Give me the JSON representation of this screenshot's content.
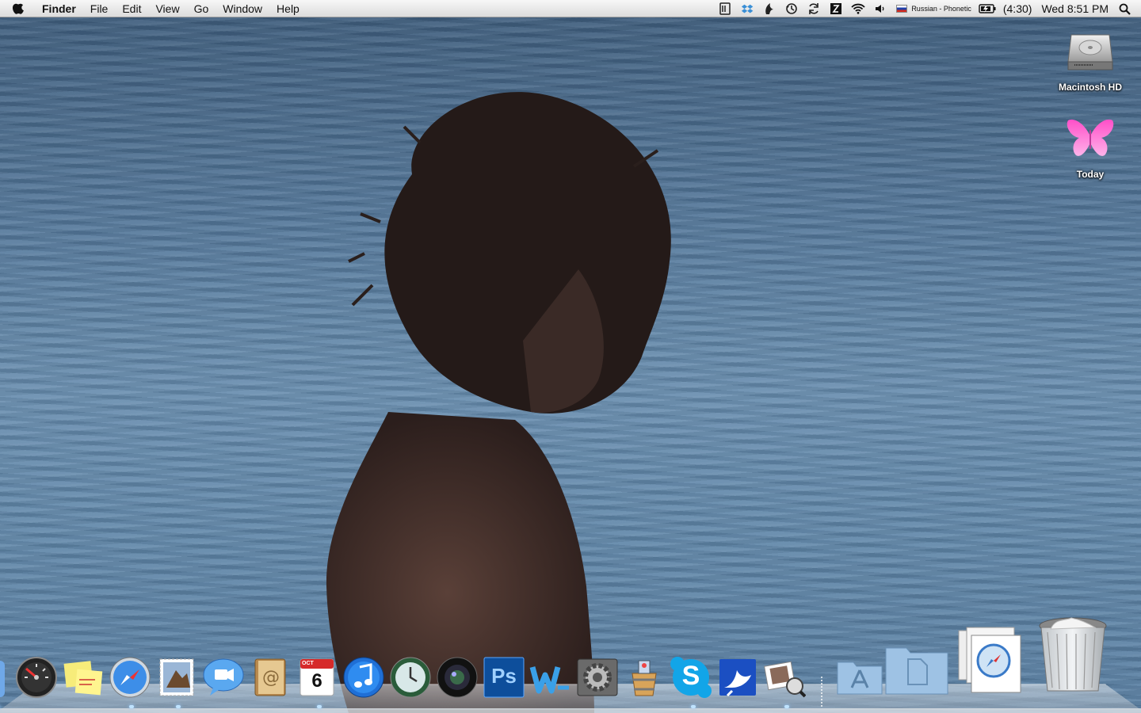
{
  "menubar": {
    "app_name": "Finder",
    "menus": [
      "File",
      "Edit",
      "View",
      "Go",
      "Window",
      "Help"
    ],
    "status": {
      "input_source": "Russian - Phonetic",
      "battery_time": "(4:30)",
      "clock": "Wed 8:51 PM"
    }
  },
  "desktop": {
    "icons": [
      {
        "label": "Macintosh HD",
        "icon": "hard-drive-icon"
      },
      {
        "label": "Today",
        "icon": "butterfly-icon"
      }
    ]
  },
  "dock": {
    "apps": [
      "Dashboard",
      "Stickies",
      "Safari",
      "Mail",
      "iChat",
      "Address Book",
      "iCal",
      "iTunes",
      "Time Machine",
      "Photo Booth",
      "Photoshop",
      "Word",
      "System Preferences",
      "Cider",
      "Skype",
      "Dictionary",
      "Preview"
    ],
    "calendar": {
      "month": "OCT",
      "day": "6"
    },
    "photoshop_label": "Ps",
    "skype_label": "S"
  },
  "colors": {
    "accent_blue": "#1f6fd6",
    "photoshop_bg": "#0d4e9b",
    "skype_blue": "#12a5e8"
  }
}
